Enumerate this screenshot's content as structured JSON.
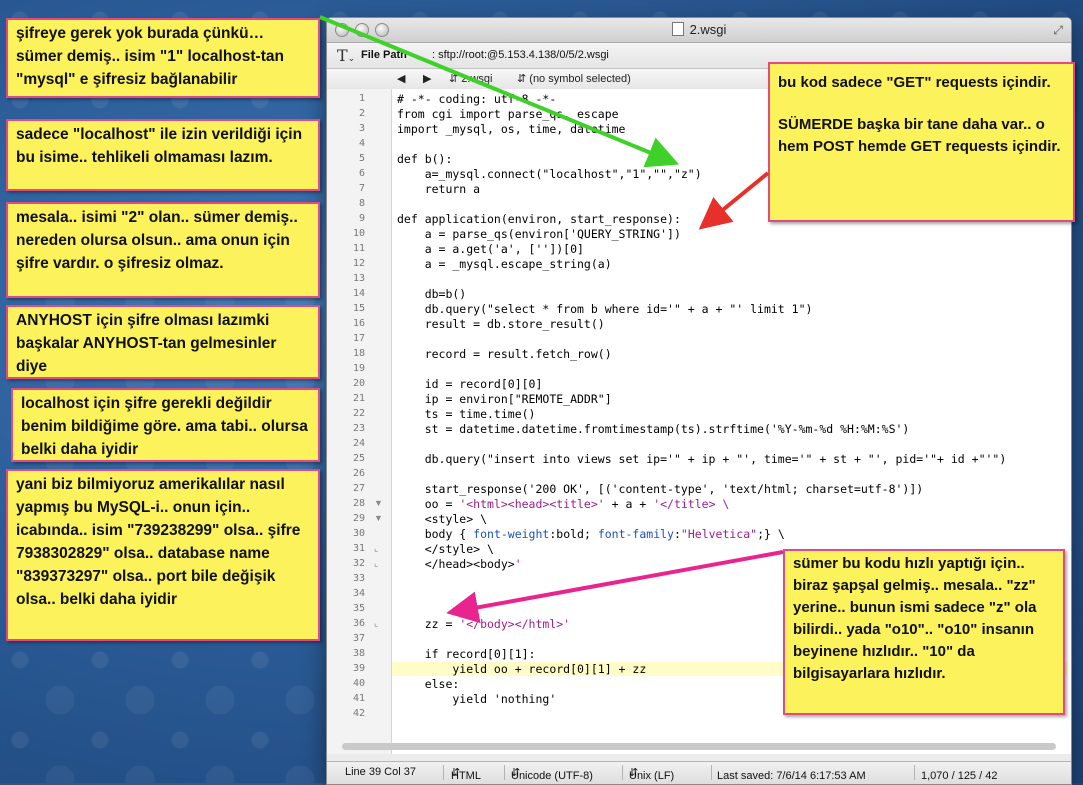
{
  "window": {
    "title": "2.wsgi",
    "path_label": "File Path",
    "path_value": ": sftp://root:@5.153.4.138/0/5/2.wsgi",
    "nav": {
      "file": "2.wsgi",
      "symbol": "(no symbol selected)"
    }
  },
  "code_lines": [
    {
      "n": "1",
      "t": "# -*- coding: utf-8 -*-"
    },
    {
      "n": "2",
      "t": "from cgi import parse_qs, escape"
    },
    {
      "n": "3",
      "t": "import _mysql, os, time, datetime"
    },
    {
      "n": "4",
      "t": ""
    },
    {
      "n": "5",
      "t": "def b():"
    },
    {
      "n": "6",
      "t": "    a=_mysql.connect(\"localhost\",\"1\",\"\",\"z\")"
    },
    {
      "n": "7",
      "t": "    return a"
    },
    {
      "n": "8",
      "t": ""
    },
    {
      "n": "9",
      "t": "def application(environ, start_response):"
    },
    {
      "n": "10",
      "t": "    a = parse_qs(environ['QUERY_STRING'])"
    },
    {
      "n": "11",
      "t": "    a = a.get('a', [''])[0]"
    },
    {
      "n": "12",
      "t": "    a = _mysql.escape_string(a)"
    },
    {
      "n": "13",
      "t": ""
    },
    {
      "n": "14",
      "t": "    db=b()"
    },
    {
      "n": "15",
      "t": "    db.query(\"select * from b where id='\" + a + \"' limit 1\")"
    },
    {
      "n": "16",
      "t": "    result = db.store_result()"
    },
    {
      "n": "17",
      "t": ""
    },
    {
      "n": "18",
      "t": "    record = result.fetch_row()"
    },
    {
      "n": "19",
      "t": ""
    },
    {
      "n": "20",
      "t": "    id = record[0][0]"
    },
    {
      "n": "21",
      "t": "    ip = environ[\"REMOTE_ADDR\"]"
    },
    {
      "n": "22",
      "t": "    ts = time.time()"
    },
    {
      "n": "23",
      "t": "    st = datetime.datetime.fromtimestamp(ts).strftime('%Y-%m-%d %H:%M:%S')"
    },
    {
      "n": "24",
      "t": ""
    },
    {
      "n": "25",
      "t": "    db.query(\"insert into views set ip='\" + ip + \"', time='\" + st + \"', pid='\"+ id +\"'\")"
    },
    {
      "n": "26",
      "t": ""
    },
    {
      "n": "27",
      "t": "    start_response('200 OK', [('content-type', 'text/html; charset=utf-8')])"
    },
    {
      "n": "28",
      "t": "    oo = '<html><head><title>' + a + '</title> \\"
    },
    {
      "n": "29",
      "t": "    <style> \\"
    },
    {
      "n": "30",
      "t": "    body { font-weight:bold; font-family:\"Helvetica\";} \\"
    },
    {
      "n": "31",
      "t": "    </style> \\"
    },
    {
      "n": "32",
      "t": "    </head><body>'"
    },
    {
      "n": "33",
      "t": ""
    },
    {
      "n": "34",
      "t": ""
    },
    {
      "n": "35",
      "t": ""
    },
    {
      "n": "36",
      "t": "    zz = '</body></html>'"
    },
    {
      "n": "37",
      "t": ""
    },
    {
      "n": "38",
      "t": "    if record[0][1]:"
    },
    {
      "n": "39",
      "t": "        yield oo + record[0][1] + zz"
    },
    {
      "n": "40",
      "t": "    else:"
    },
    {
      "n": "41",
      "t": "        yield 'nothing'"
    },
    {
      "n": "42",
      "t": ""
    }
  ],
  "status": {
    "position": "Line 39 Col 37",
    "language": "HTML",
    "encoding": "Unicode (UTF-8)",
    "line_endings": "Unix (LF)",
    "saved": "Last saved: 7/6/14 6:17:53 AM",
    "counts": "1,070 / 125 / 42"
  },
  "notes": {
    "n1": "şifreye gerek yok burada çünkü… sümer demiş.. isim \"1\" localhost-tan \"mysql\" e şifresiz bağlanabilir",
    "n2": "sadece \"localhost\" ile izin verildiği için bu isime.. tehlikeli olmaması lazım.",
    "n3": "mesala.. isimi \"2\" olan.. sümer demiş.. nereden olursa olsun.. ama onun için şifre vardır. o şifresiz olmaz.",
    "n4": "ANYHOST için şifre olması lazımki başkalar ANYHOST-tan gelmesinler diye",
    "n5": "localhost için şifre gerekli değildir benim bildiğime göre. ama tabi.. olursa belki daha iyidir",
    "n6": "yani biz bilmiyoruz amerikalılar nasıl yapmış bu MySQL-i.. onun için.. icabında.. isim \"739238299\" olsa.. şifre 7938302829\" olsa.. database name \"839373297\" olsa.. port bile değişik olsa.. belki daha iyidir",
    "r1a": "bu kod sadece \"GET\" requests içindir.",
    "r1b": "SÜMERDE başka bir tane daha var.. o hem POST hemde GET requests içindir.",
    "r2": "sümer bu kodu hızlı yaptığı için.. biraz şapşal gelmiş.. mesala.. \"zz\" yerine.. bunun ismi sadece \"z\" ola bilirdi.. yada \"o10\".. \"o10\" insanın beyinene hızlıdır.. \"10\" da bilgisayarlara hızlıdır."
  },
  "colors": {
    "accent_pink": "#e04b87",
    "note_yellow": "#fbf25c",
    "arrow_green": "#3fd12a",
    "arrow_red": "#e8302a",
    "arrow_magenta": "#e8248e"
  }
}
